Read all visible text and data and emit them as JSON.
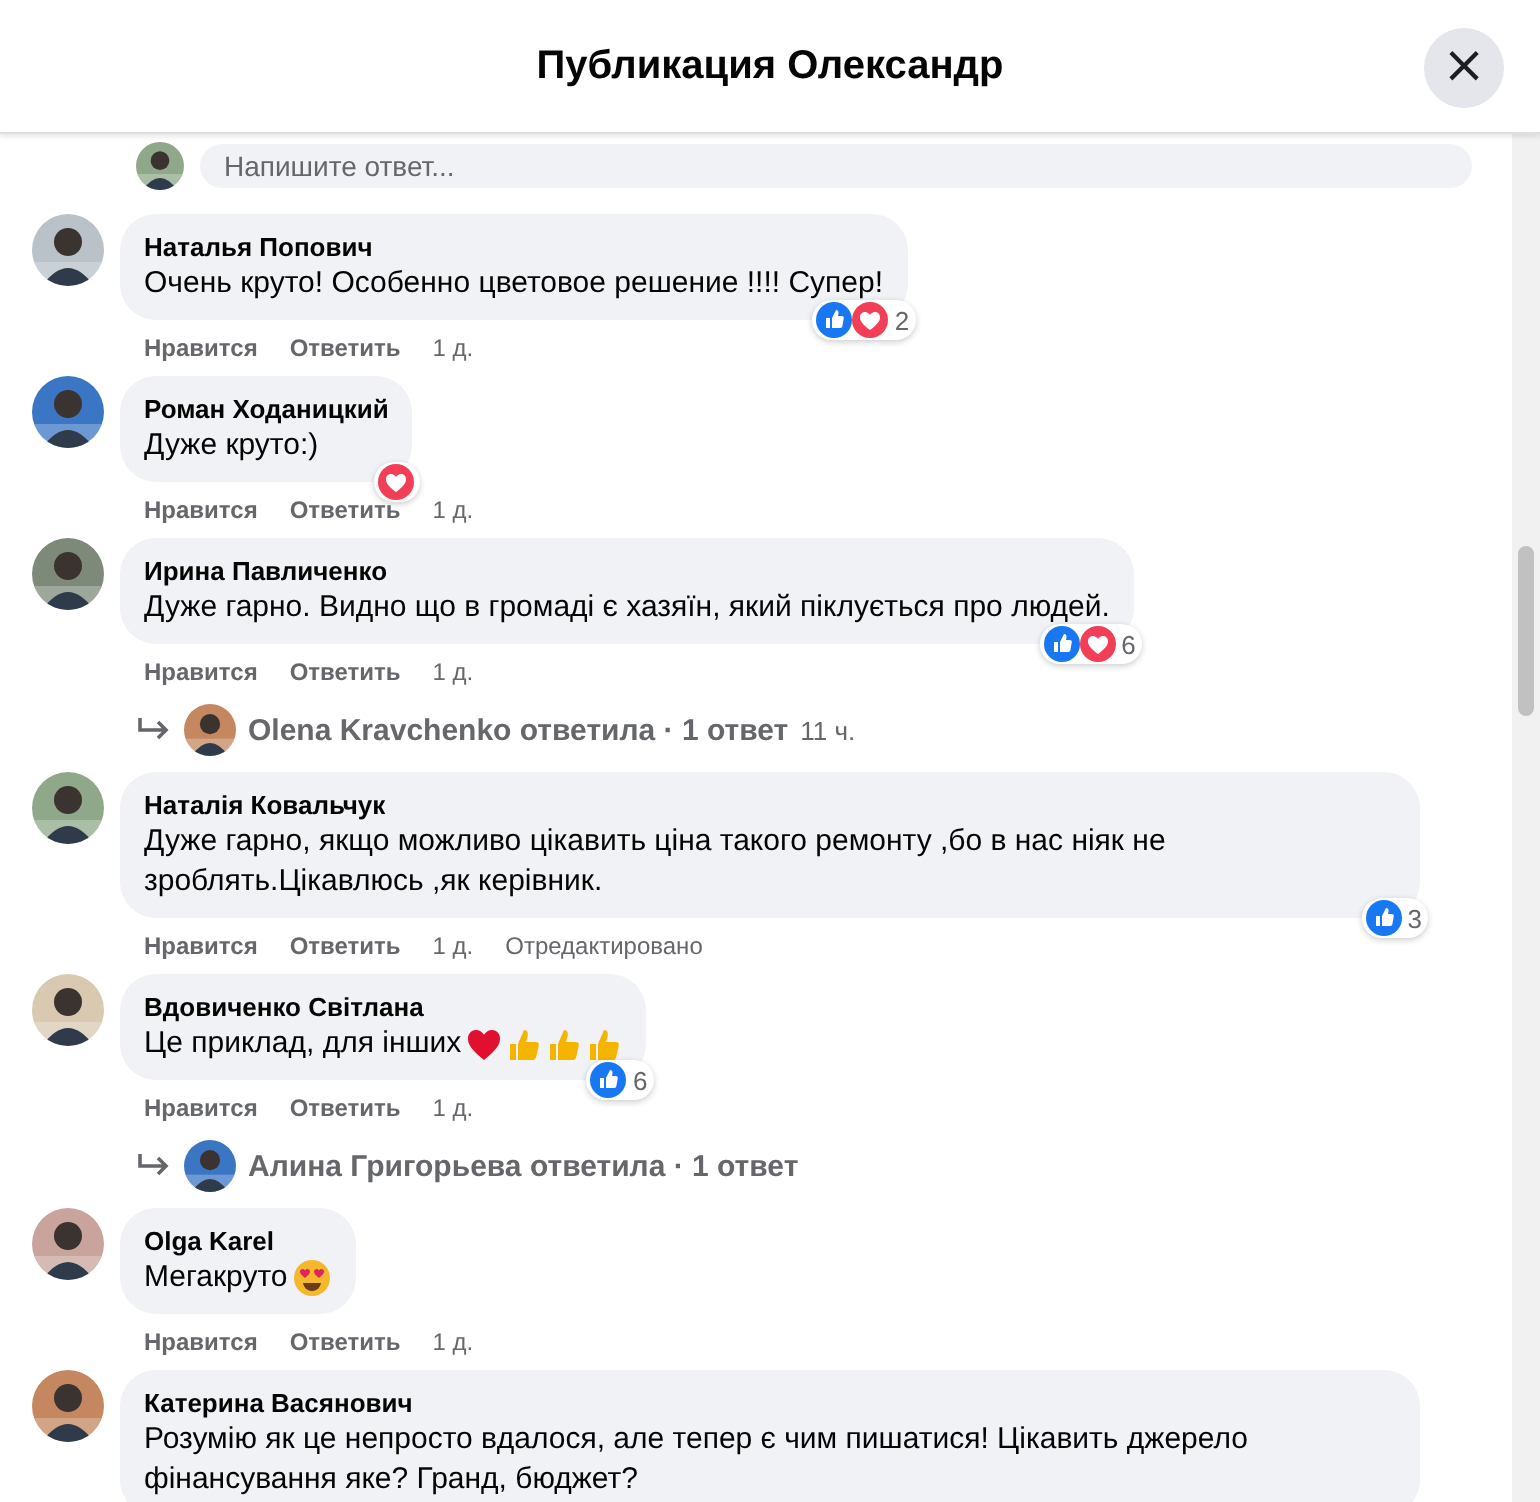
{
  "header": {
    "title": "Публикация Олександр",
    "close": "×"
  },
  "reply_field": {
    "placeholder": "Напишите ответ..."
  },
  "comments": [
    {
      "author": "Наталья Попович",
      "text": "Очень круто! Особенно цветовое решение !!!! Супер!",
      "reactions": [
        {
          "kind": "like"
        },
        {
          "kind": "love"
        }
      ],
      "reaction_count": "2",
      "like": "Нравится",
      "reply": "Ответить",
      "time": "1 д."
    },
    {
      "author": "Роман Ходаницкий",
      "text": "Дуже круто:)",
      "reactions": [
        {
          "kind": "love"
        }
      ],
      "like": "Нравится",
      "reply": "Ответить",
      "time": "1 д."
    },
    {
      "author": "Ирина Павличенко",
      "text": "Дуже гарно. Видно що в громаді є хазяїн, який піклується про людей.",
      "reactions": [
        {
          "kind": "like"
        },
        {
          "kind": "love"
        }
      ],
      "reaction_count": "6",
      "like": "Нравится",
      "reply": "Ответить",
      "time": "1 д.",
      "replies": {
        "summary": "Olena Kravchenko ответила · 1 ответ",
        "time": "11 ч."
      }
    },
    {
      "author": "Наталія Ковальчук",
      "text": "Дуже гарно, якщо можливо цікавить ціна такого ремонту ,бо в нас ніяк не зроблять.Цікавлюсь ,як керівник.",
      "reactions": [
        {
          "kind": "like"
        }
      ],
      "reaction_count": "3",
      "like": "Нравится",
      "reply": "Ответить",
      "time": "1 д.",
      "edited": "Отредактировано"
    },
    {
      "author": "Вдовиченко Світлана",
      "text": "Це приклад, для інших",
      "emoji": [
        {
          "kind": "heart"
        },
        {
          "kind": "thumbs-up"
        },
        {
          "kind": "thumbs-up"
        },
        {
          "kind": "thumbs-up"
        }
      ],
      "reactions": [
        {
          "kind": "like"
        }
      ],
      "reaction_count": "6",
      "like": "Нравится",
      "reply": "Ответить",
      "time": "1 д.",
      "replies": {
        "summary": "Алина Григорьева ответила · 1 ответ"
      }
    },
    {
      "author": "Olga Karel",
      "text": "Мегакруто",
      "emoji": [
        {
          "kind": "heart-eyes"
        }
      ],
      "like": "Нравится",
      "reply": "Ответить",
      "time": "1 д."
    },
    {
      "author": "Катерина Васянович",
      "text": "Розумію як це непросто вдалося, але тепер є чим пишатися! Цікавить джерело фінансування яке? Гранд, бюджет?"
    }
  ]
}
